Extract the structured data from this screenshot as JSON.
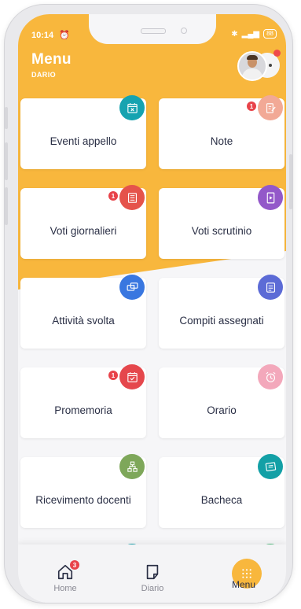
{
  "status_bar": {
    "time": "10:14",
    "battery": "88"
  },
  "header": {
    "title": "Menu",
    "subtitle": "DARIO"
  },
  "tiles": [
    {
      "label": "Eventi appello",
      "icon": "calendar-x-icon",
      "color": "#16a3b0",
      "badge": ""
    },
    {
      "label": "Note",
      "icon": "note-edit-icon",
      "color": "#f2a996",
      "badge": "1"
    },
    {
      "label": "Voti giornalieri",
      "icon": "grade-list-icon",
      "color": "#e5534b",
      "badge": "1"
    },
    {
      "label": "Voti scrutinio",
      "icon": "report-card-icon",
      "color": "#9358c9",
      "badge": ""
    },
    {
      "label": "Attività svolta",
      "icon": "activity-chat-icon",
      "color": "#3977e0",
      "badge": ""
    },
    {
      "label": "Compiti assegnati",
      "icon": "homework-icon",
      "color": "#5c6bd6",
      "badge": ""
    },
    {
      "label": "Promemoria",
      "icon": "calendar-check-icon",
      "color": "#e5474c",
      "badge": "1"
    },
    {
      "label": "Orario",
      "icon": "alarm-clock-icon",
      "color": "#f3a8bb",
      "badge": ""
    },
    {
      "label": "Ricevimento docenti",
      "icon": "meeting-icon",
      "color": "#7ea75a",
      "badge": ""
    },
    {
      "label": "Bacheca",
      "icon": "board-icon",
      "color": "#13a0a6",
      "badge": ""
    },
    {
      "label": "",
      "icon": "clipboard-icon",
      "color": "#17a3ad",
      "badge": ""
    },
    {
      "label": "",
      "icon": "document-icon",
      "color": "#4dba7a",
      "badge": ""
    }
  ],
  "tabbar": {
    "home": {
      "label": "Home",
      "badge": "3"
    },
    "diario": {
      "label": "Diario"
    },
    "menu": {
      "label": "Menu"
    }
  },
  "colors": {
    "accent": "#f8b73d",
    "text": "#2a2f45",
    "badge": "#e8434a"
  }
}
